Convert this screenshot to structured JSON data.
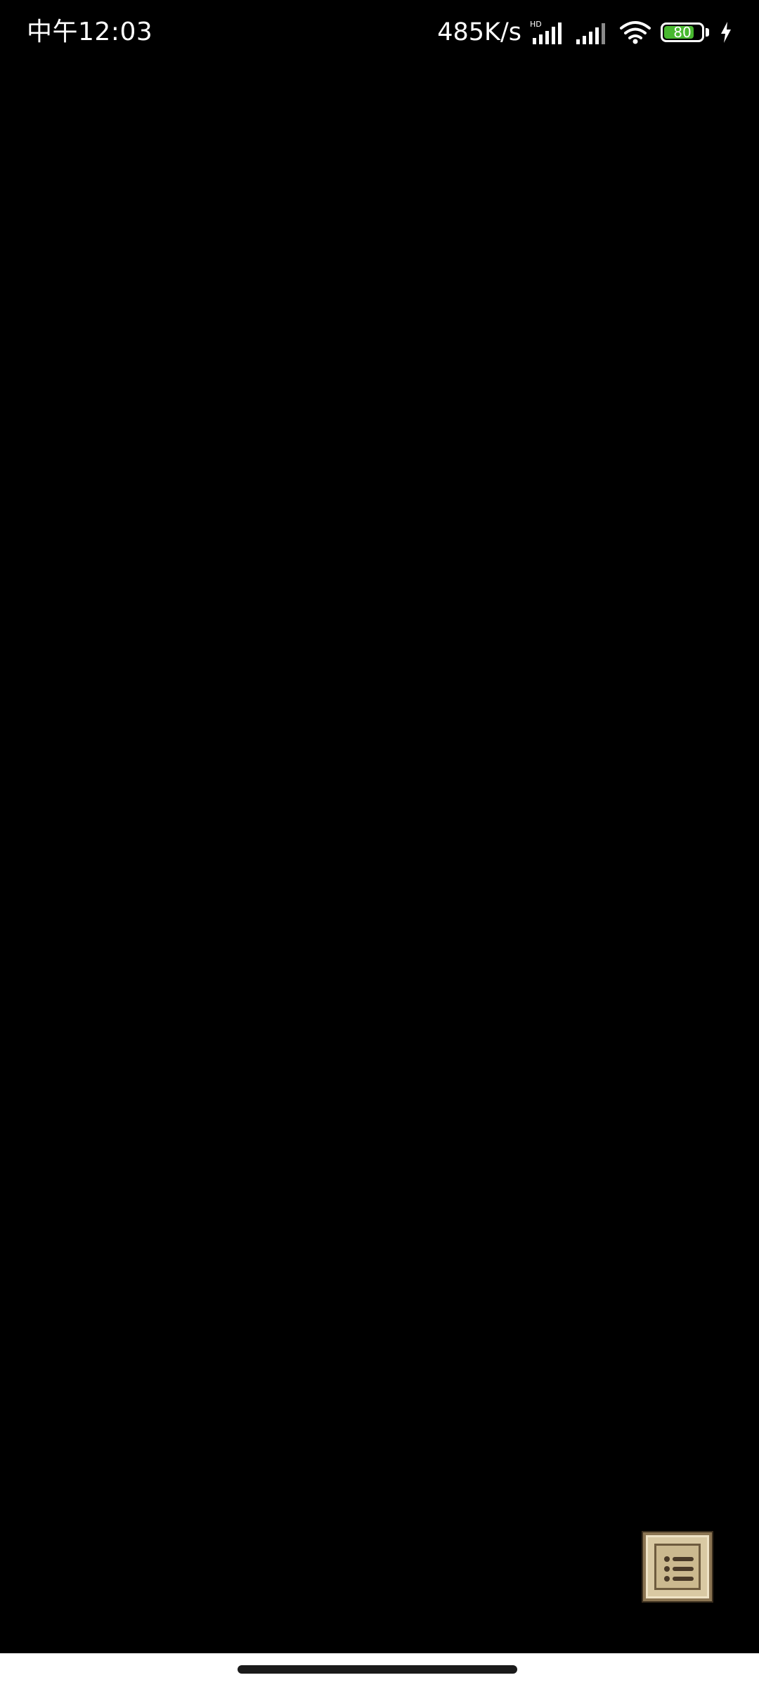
{
  "status_bar": {
    "time": "中午12:03",
    "net_speed": "485K/s",
    "hd_badge": "HD",
    "battery_level": "80",
    "battery_fraction": 0.8,
    "charging": true,
    "icons": [
      "signal-hd-icon",
      "signal-icon",
      "wifi-icon",
      "battery-icon",
      "charging-bolt-icon"
    ]
  },
  "main": {
    "background": "#000000"
  },
  "menu_button": {
    "icon": "list-menu-icon",
    "colors": {
      "face": "#d9c9a3",
      "border": "#8b7553",
      "glyph": "#4a3a28"
    }
  },
  "colors": {
    "battery_fill": "#48b82f",
    "nav_bar": "#ffffff",
    "home_indicator": "#1a1a1a"
  }
}
